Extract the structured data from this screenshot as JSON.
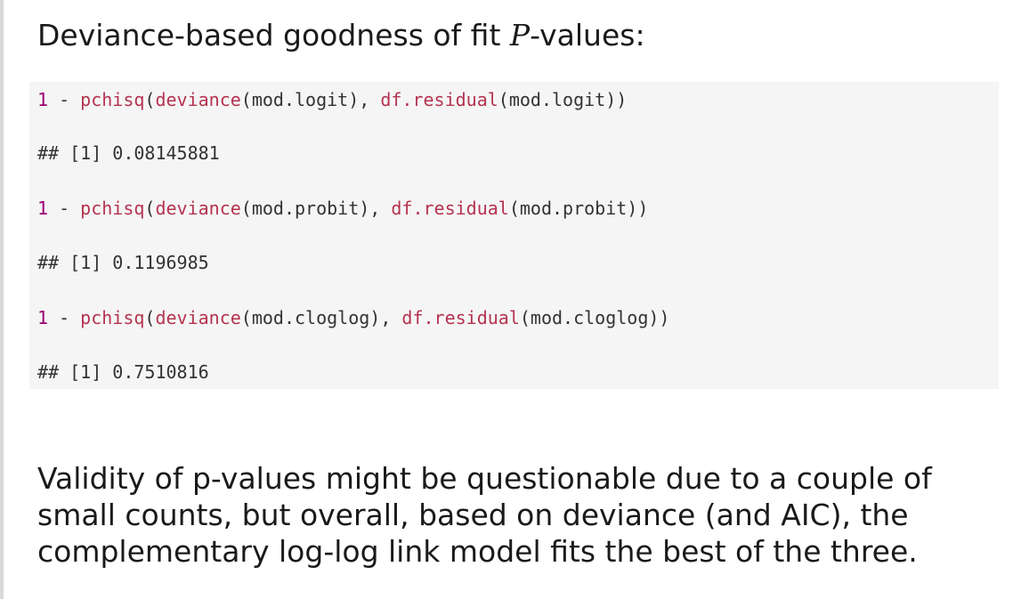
{
  "heading": {
    "prefix": "Deviance-based goodness of fit ",
    "math": "P",
    "suffix": "-values:"
  },
  "code": {
    "blocks": [
      {
        "num": "1",
        "op": " - ",
        "fn1": "pchisq",
        "open1": "(",
        "fn2": "deviance",
        "arg1": "(mod.logit), ",
        "fn3": "df.residual",
        "arg2": "(mod.logit))",
        "output": "## [1] 0.08145881"
      },
      {
        "num": "1",
        "op": " - ",
        "fn1": "pchisq",
        "open1": "(",
        "fn2": "deviance",
        "arg1": "(mod.probit), ",
        "fn3": "df.residual",
        "arg2": "(mod.probit))",
        "output": "## [1] 0.1196985"
      },
      {
        "num": "1",
        "op": " - ",
        "fn1": "pchisq",
        "open1": "(",
        "fn2": "deviance",
        "arg1": "(mod.cloglog), ",
        "fn3": "df.residual",
        "arg2": "(mod.cloglog))",
        "output": "## [1] 0.7510816"
      }
    ],
    "colors": {
      "background": "#f5f5f5",
      "number": "#990073",
      "function": "#b5334f",
      "text": "#333333"
    }
  },
  "paragraph": "Validity of p-values might be questionable due to a couple of small counts, but overall, based on deviance (and AIC), the complementary log-log link model fits the best of the three."
}
